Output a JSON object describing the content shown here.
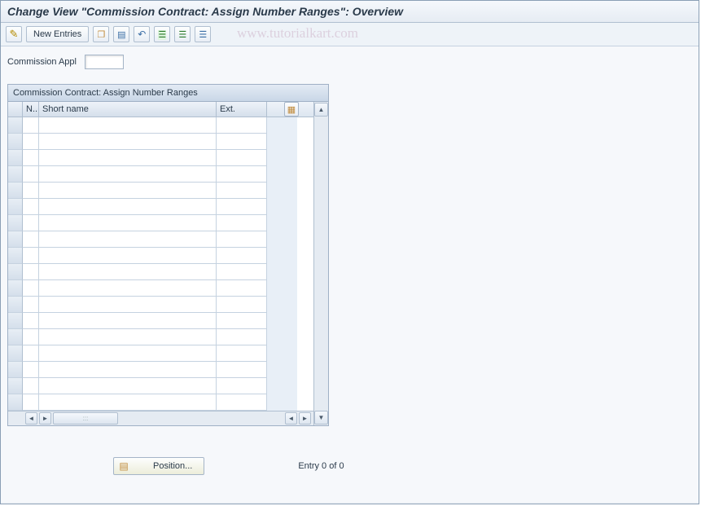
{
  "title": "Change View \"Commission Contract: Assign Number Ranges\": Overview",
  "toolbar": {
    "new_entries_label": "New Entries",
    "icons": {
      "change": "change-icon",
      "copy": "copy-as-icon",
      "delete": "delete-icon",
      "undo": "undo-change-icon",
      "select_all": "select-all-icon",
      "select_block": "select-block-icon",
      "deselect_all": "deselect-all-icon"
    }
  },
  "watermark": "www.tutorialkart.com",
  "fields": {
    "commission_appl_label": "Commission Appl",
    "commission_appl_value": ""
  },
  "table": {
    "title": "Commission Contract: Assign Number Ranges",
    "columns": {
      "n": "N..",
      "short_name": "Short name",
      "ext": "Ext."
    },
    "rows": [
      {
        "n": "",
        "short_name": "",
        "ext": ""
      },
      {
        "n": "",
        "short_name": "",
        "ext": ""
      },
      {
        "n": "",
        "short_name": "",
        "ext": ""
      },
      {
        "n": "",
        "short_name": "",
        "ext": ""
      },
      {
        "n": "",
        "short_name": "",
        "ext": ""
      },
      {
        "n": "",
        "short_name": "",
        "ext": ""
      },
      {
        "n": "",
        "short_name": "",
        "ext": ""
      },
      {
        "n": "",
        "short_name": "",
        "ext": ""
      },
      {
        "n": "",
        "short_name": "",
        "ext": ""
      },
      {
        "n": "",
        "short_name": "",
        "ext": ""
      },
      {
        "n": "",
        "short_name": "",
        "ext": ""
      },
      {
        "n": "",
        "short_name": "",
        "ext": ""
      },
      {
        "n": "",
        "short_name": "",
        "ext": ""
      },
      {
        "n": "",
        "short_name": "",
        "ext": ""
      },
      {
        "n": "",
        "short_name": "",
        "ext": ""
      },
      {
        "n": "",
        "short_name": "",
        "ext": ""
      },
      {
        "n": "",
        "short_name": "",
        "ext": ""
      },
      {
        "n": "",
        "short_name": "",
        "ext": ""
      }
    ]
  },
  "footer": {
    "position_label": "Position...",
    "entry_status": "Entry 0 of 0"
  }
}
